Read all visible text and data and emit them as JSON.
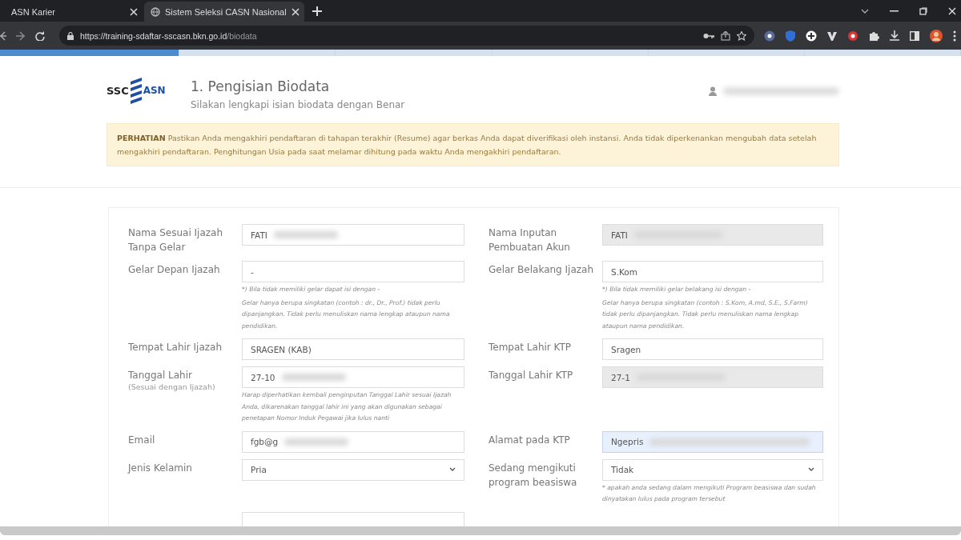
{
  "browser": {
    "tabs": [
      {
        "title": "ASN Karier",
        "selected": false
      },
      {
        "title": "Sistem Seleksi CASN Nasional",
        "selected": true
      }
    ],
    "url": {
      "host": "https://training-sdaftar-sscasn.bkn.go.id",
      "path": "/biodata"
    }
  },
  "steps": [
    {
      "selected": true
    },
    {
      "selected": false
    },
    {
      "selected": false
    },
    {
      "selected": false
    },
    {
      "selected": false
    },
    {
      "selected": false
    }
  ],
  "header": {
    "logo": {
      "left": "SSC",
      "right": "ASN"
    },
    "title": "1. Pengisian Biodata",
    "subtitle": "Silakan lengkapi isian biodata dengan Benar",
    "user_redacted": true
  },
  "alert": "**PERHATIAN** Pastikan Anda mengakhiri pendaftaran di tahapan terakhir (Resume) agar berkas Anda dapat diverifikasi oleh instansi. Anda tidak diperkenankan mengubah data setelah mengakhiri pendaftaran. Penghitungan Usia pada saat melamar dihitung pada waktu Anda mengakhiri pendaftaran.",
  "form": {
    "rows": [
      {
        "fields": [
          {
            "label": "Nama Sesuai Ijazah Tanpa Gelar",
            "kind": "text",
            "value": "FATI",
            "redacted": true,
            "disabled": false,
            "focused": false
          },
          {
            "label": "Nama Inputan Pembuatan Akun",
            "kind": "text",
            "value": "FATI",
            "redacted": true,
            "disabled": true,
            "focused": false
          }
        ]
      },
      {
        "fields": [
          {
            "label": "Gelar Depan Ijazah",
            "kind": "text",
            "value": "-",
            "redacted": false,
            "disabled": false,
            "focused": false,
            "help": [
              "*) Bila tidak memiliki gelar dapat isi dengan -",
              "Gelar hanya berupa singkatan (contoh : dr., Dr., Prof.) tidak perlu dipanjangkan. Tidak perlu menuliskan nama lengkap ataupun nama pendidikan."
            ]
          },
          {
            "label": "Gelar Belakang Ijazah",
            "kind": "text",
            "value": "S.Kom",
            "redacted": false,
            "disabled": false,
            "focused": false,
            "help": [
              "*) Bila tidak memiliki gelar belakang isi dengan -",
              "Gelar hanya berupa singkatan (contoh : S.Kom, A.md, S.E., S.Farm) tidak perlu dipanjangkan. Tidak perlu menuliskan nama lengkap ataupun nama pendidikan."
            ]
          }
        ]
      },
      {
        "fields": [
          {
            "label": "Tempat Lahir Ijazah",
            "kind": "text",
            "value": "SRAGEN (KAB)",
            "redacted": false,
            "disabled": false,
            "focused": false
          },
          {
            "label": "Tempat Lahir KTP",
            "kind": "text",
            "value": "Sragen",
            "redacted": false,
            "disabled": false,
            "focused": false
          }
        ]
      },
      {
        "fields": [
          {
            "label": "Tanggal Lahir",
            "label_note": "(Sesuai dengan Ijazah)",
            "kind": "text",
            "value": "27-10",
            "redacted": true,
            "disabled": false,
            "focused": false,
            "help": [
              "Harap diperhatikan kembali penginputan Tanggal Lahir sesuai Ijazah Anda, dikarenakan tanggal lahir ini yang akan digunakan sebagai penetapan Nomor Induk Pegawai jika lulus nanti"
            ]
          },
          {
            "label": "Tanggal Lahir KTP",
            "kind": "text",
            "value": "27-1",
            "redacted": true,
            "disabled": true,
            "focused": false
          }
        ]
      },
      {
        "fields": [
          {
            "label": "Email",
            "kind": "text",
            "value": "fgb@g",
            "redacted": true,
            "disabled": false,
            "focused": false
          },
          {
            "label": "Alamat pada KTP",
            "kind": "text",
            "value": "Ngepris",
            "redacted": true,
            "disabled": false,
            "focused": true
          }
        ]
      },
      {
        "fields": [
          {
            "label": "Jenis Kelamin",
            "kind": "select",
            "value": "Pria",
            "redacted": false,
            "disabled": false,
            "focused": false
          },
          {
            "label": "Sedang mengikuti program beasiswa",
            "kind": "select",
            "value": "Tidak",
            "redacted": false,
            "disabled": false,
            "focused": false,
            "help": [
              "* apakah anda sedang dalam mengikuti Program beasiswa dan sudah dinyatakan lulus pada program tersebut"
            ]
          }
        ]
      },
      {
        "fields": [
          {
            "kind": "text"
          }
        ]
      }
    ]
  }
}
